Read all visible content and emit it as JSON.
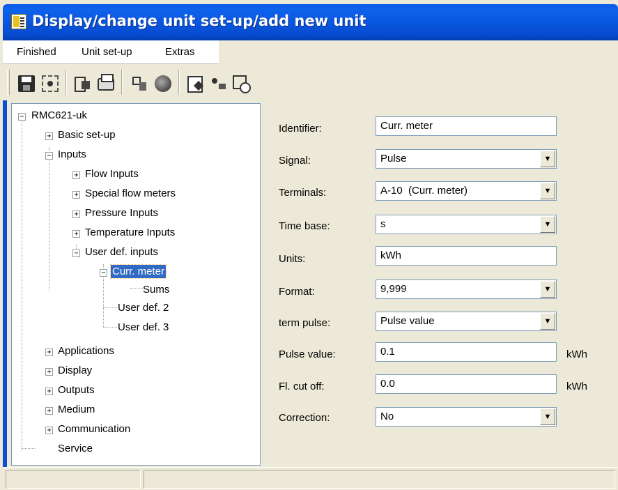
{
  "window": {
    "title": "Display/change unit set-up/add new unit"
  },
  "menu": {
    "items": [
      "Finished",
      "Unit set-up",
      "Extras"
    ]
  },
  "toolbar": {
    "icons": [
      "save-icon",
      "debug-icon",
      "database-icon",
      "print-icon",
      "tree-icon",
      "globe-icon",
      "properties-icon",
      "connect-icon",
      "clock-icon"
    ]
  },
  "tree": {
    "root": "RMC621-uk",
    "basic_setup": "Basic set-up",
    "inputs": "Inputs",
    "flow_inputs": "Flow Inputs",
    "special_flow": "Special flow meters",
    "pressure_inputs": "Pressure Inputs",
    "temperature_inputs": "Temperature Inputs",
    "user_def_inputs": "User def. inputs",
    "curr_meter": "Curr. meter",
    "sums": "Sums",
    "user_def_2": "User def. 2",
    "user_def_3": "User def. 3",
    "applications": "Applications",
    "display": "Display",
    "outputs": "Outputs",
    "medium": "Medium",
    "communication": "Communication",
    "service": "Service",
    "selected": "Curr. meter"
  },
  "form": {
    "identifier": {
      "label": "Identifier:",
      "value": "Curr. meter"
    },
    "signal": {
      "label": "Signal:",
      "value": "Pulse"
    },
    "terminals": {
      "label": "Terminals:",
      "value": "A-10  (Curr. meter)"
    },
    "time_base": {
      "label": "Time base:",
      "value": "s"
    },
    "units": {
      "label": "Units:",
      "value": "kWh"
    },
    "format": {
      "label": "Format:",
      "value": "9,999"
    },
    "term_pulse": {
      "label": "term pulse:",
      "value": "Pulse value"
    },
    "pulse_value": {
      "label": "Pulse value:",
      "value": "0.1",
      "unit": "kWh"
    },
    "fl_cut_off": {
      "label": "Fl. cut off:",
      "value": "0.0",
      "unit": "kWh"
    },
    "correction": {
      "label": "Correction:",
      "value": "No"
    }
  },
  "status": {
    "panel1": "",
    "panel2": ""
  },
  "colors": {
    "titlebar": "#0a56df",
    "selection": "#316ac5",
    "background": "#ece9d8"
  }
}
